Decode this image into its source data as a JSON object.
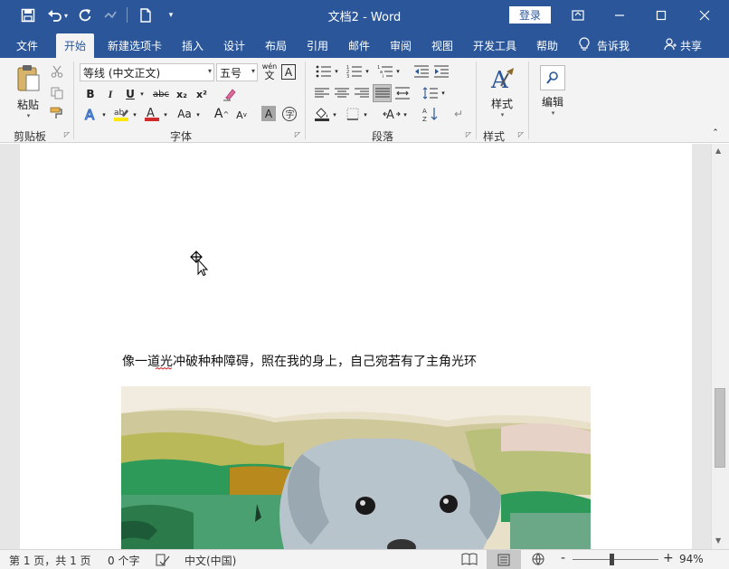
{
  "titlebar": {
    "title": "文档2 - Word",
    "login_label": "登录",
    "colors": {
      "brand": "#2b579a"
    }
  },
  "tabs": [
    "文件",
    "开始",
    "新建选项卡",
    "插入",
    "设计",
    "布局",
    "引用",
    "邮件",
    "审阅",
    "视图",
    "开发工具",
    "帮助"
  ],
  "active_tab": "开始",
  "tell_me": "告诉我",
  "share": "共享",
  "ribbon": {
    "clipboard": {
      "paste": "粘贴",
      "label": "剪贴板"
    },
    "font": {
      "font_name": "等线 (中文正文)",
      "font_size": "五号",
      "bold": "B",
      "italic": "I",
      "underline": "U",
      "strike": "abc",
      "sub": "x₂",
      "sup": "x²",
      "grow": "A",
      "shrink": "A",
      "aa": "Aa",
      "label": "字体",
      "wen": "wén",
      "wen_char": "文"
    },
    "paragraph": {
      "label": "段落"
    },
    "styles": {
      "button": "样式",
      "label": "样式"
    },
    "editing": {
      "button": "编辑"
    }
  },
  "document": {
    "text": "像一道光冲破种种障碍，照在我的身上，自己宛若有了主角光环"
  },
  "statusbar": {
    "page": "第 1 页，共 1 页",
    "words": "0 个字",
    "language": "中文(中国)",
    "zoom": "94%",
    "minus": "-",
    "plus": "+"
  }
}
